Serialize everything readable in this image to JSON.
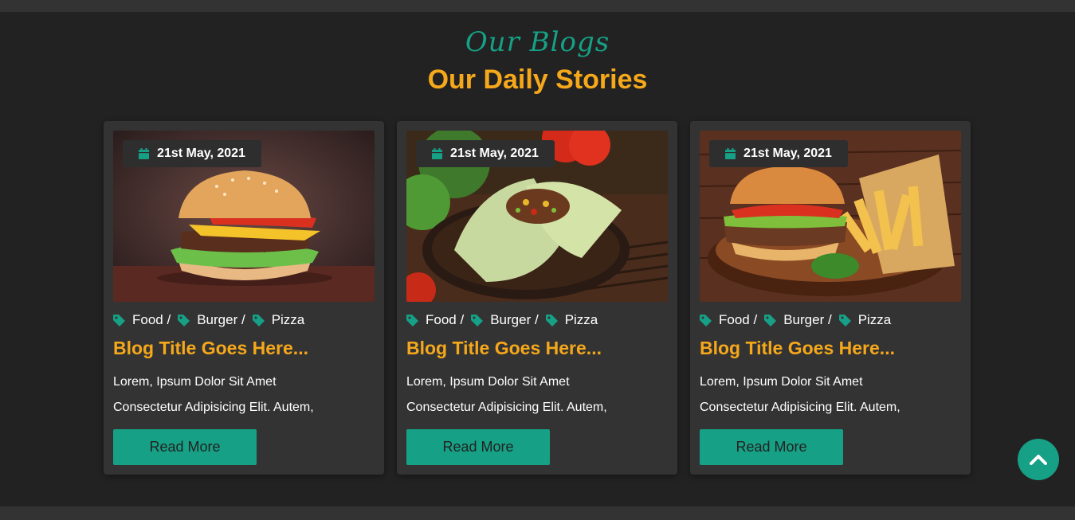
{
  "section": {
    "subtitle": "Our Blogs",
    "title": "Our Daily Stories"
  },
  "cards": [
    {
      "date": "21st May, 2021",
      "image": "burger-photo",
      "tags": [
        "Food /",
        "Burger /",
        "Pizza"
      ],
      "title": "Blog Title Goes Here...",
      "text_line1": "Lorem, Ipsum Dolor Sit Amet",
      "text_line2": "Consectetur Adipisicing Elit. Autem,",
      "button": "Read More"
    },
    {
      "date": "21st May, 2021",
      "image": "wrap-photo",
      "tags": [
        "Food /",
        "Burger /",
        "Pizza"
      ],
      "title": "Blog Title Goes Here...",
      "text_line1": "Lorem, Ipsum Dolor Sit Amet",
      "text_line2": "Consectetur Adipisicing Elit. Autem,",
      "button": "Read More"
    },
    {
      "date": "21st May, 2021",
      "image": "burger-fries-photo",
      "tags": [
        "Food /",
        "Burger /",
        "Pizza"
      ],
      "title": "Blog Title Goes Here...",
      "text_line1": "Lorem, Ipsum Dolor Sit Amet",
      "text_line2": "Consectetur Adipisicing Elit. Autem,",
      "button": "Read More"
    }
  ],
  "icons": {
    "date": "calendar-icon",
    "tag": "tag-icon",
    "scroll_top": "chevron-up-icon"
  },
  "colors": {
    "accent": "#16a085",
    "title": "#f6a81b",
    "background": "#222222",
    "card": "#333333"
  }
}
